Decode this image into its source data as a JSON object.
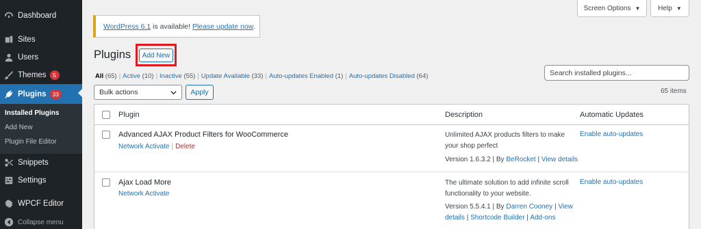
{
  "sidebar": {
    "items": [
      {
        "label": "Dashboard",
        "icon": "dashboard-icon"
      },
      {
        "label": "Sites",
        "icon": "sites-icon"
      },
      {
        "label": "Users",
        "icon": "users-icon"
      },
      {
        "label": "Themes",
        "icon": "themes-icon",
        "badge": "5"
      },
      {
        "label": "Plugins",
        "icon": "plugins-icon",
        "badge": "33"
      },
      {
        "label": "Snippets",
        "icon": "snippets-icon"
      },
      {
        "label": "Settings",
        "icon": "settings-icon"
      },
      {
        "label": "WPCF Editor",
        "icon": "wpcf-icon"
      },
      {
        "label": "Collapse menu",
        "icon": "collapse-icon"
      }
    ],
    "submenu": [
      "Installed Plugins",
      "Add New",
      "Plugin File Editor"
    ]
  },
  "top_tabs": {
    "screen_options": "Screen Options",
    "help": "Help"
  },
  "notice": {
    "version_link": "WordPress 6.1",
    "middle": " is available! ",
    "update_link": "Please update now",
    "end": "."
  },
  "page": {
    "title": "Plugins",
    "add_new": "Add New"
  },
  "filters": [
    {
      "label": "All",
      "count": "(65)"
    },
    {
      "label": "Active",
      "count": "(10)"
    },
    {
      "label": "Inactive",
      "count": "(55)"
    },
    {
      "label": "Update Available",
      "count": "(33)"
    },
    {
      "label": "Auto-updates Enabled",
      "count": "(1)"
    },
    {
      "label": "Auto-updates Disabled",
      "count": "(64)"
    }
  ],
  "search": {
    "placeholder": "Search installed plugins..."
  },
  "bulk": {
    "label": "Bulk actions",
    "apply": "Apply",
    "items_count": "65 items"
  },
  "table": {
    "headers": {
      "plugin": "Plugin",
      "description": "Description",
      "auto": "Automatic Updates"
    },
    "rows": [
      {
        "name": "Advanced AJAX Product Filters for WooCommerce",
        "network_activate": "Network Activate",
        "delete": "Delete",
        "desc_line1": "Unlimited AJAX products filters to make",
        "desc_line2": "your shop perfect",
        "version": "Version 1.6.3.2",
        "by": "By",
        "author": "BeRocket",
        "view_details": "View details",
        "auto_updates": "Enable auto-updates"
      },
      {
        "name": "Ajax Load More",
        "network_activate": "Network Activate",
        "desc_line1": "The ultimate solution to add infinite scroll",
        "desc_line2": "functionality to your website.",
        "version": "Version 5.5.4.1",
        "by": "By",
        "author": "Darren Cooney",
        "view_details_1": "View",
        "view_details_2": "details",
        "shortcode_builder": "Shortcode Builder",
        "addons": "Add-ons",
        "auto_updates": "Enable auto-updates"
      }
    ]
  },
  "colors": {
    "sidebar_bg": "#1d2327",
    "accent": "#2271b1",
    "badge": "#d63638",
    "highlight_box": "#e0191f",
    "notice_border": "#dba617"
  }
}
